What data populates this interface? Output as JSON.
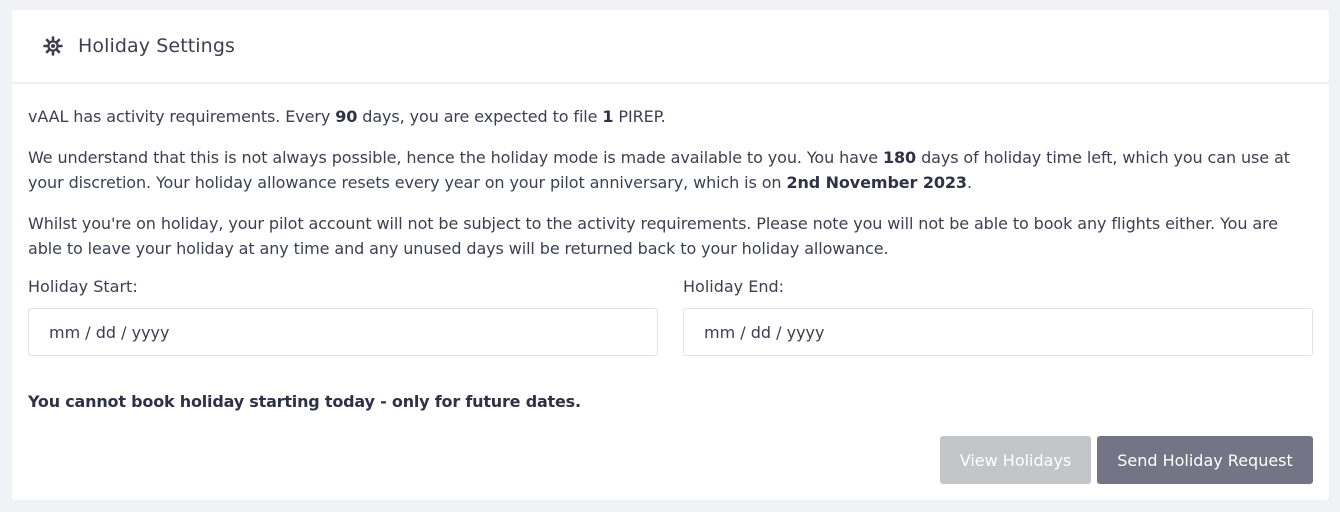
{
  "header": {
    "title": "Holiday Settings",
    "icon": "gear-icon"
  },
  "intro": {
    "p1_a": "vAAL has activity requirements. Every ",
    "p1_days": "90",
    "p1_b": " days, you are expected to file ",
    "p1_count": "1",
    "p1_c": " PIREP.",
    "p2_a": "We understand that this is not always possible, hence the holiday mode is made available to you. You have ",
    "p2_days": "180",
    "p2_b": " days of holiday time left, which you can use at your discretion. Your holiday allowance resets every year on your pilot anniversary, which is on ",
    "p2_date": "2nd November 2023",
    "p2_c": ".",
    "p3": "Whilst you're on holiday, your pilot account will not be subject to the activity requirements. Please note you will not be able to book any flights either. You are able to leave your holiday at any time and any unused days will be returned back to your holiday allowance."
  },
  "form": {
    "start_label": "Holiday Start:",
    "start_placeholder": "mm / dd / yyyy",
    "end_label": "Holiday End:",
    "end_placeholder": "mm / dd / yyyy",
    "warning": "You cannot book holiday starting today - only for future dates."
  },
  "buttons": {
    "view": "View Holidays",
    "send": "Send Holiday Request"
  },
  "colors": {
    "view_button": "#c4c5c9",
    "send_button": "#737485",
    "text": "#3c3f52"
  }
}
